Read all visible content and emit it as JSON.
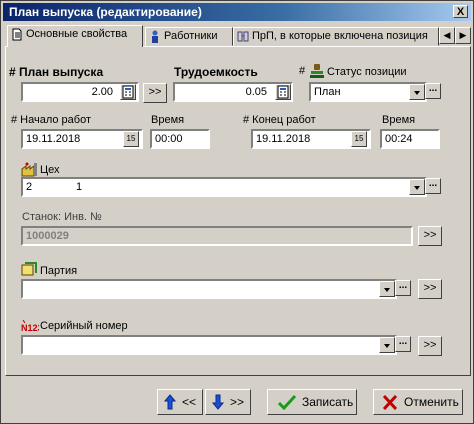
{
  "window": {
    "title": "План выпуска (редактирование)",
    "close_glyph": "X"
  },
  "tabs": [
    {
      "label": "Основные свойства",
      "icon": "document-icon",
      "active": true
    },
    {
      "label": "Работники",
      "icon": "worker-icon",
      "active": false
    },
    {
      "label": "ПрП, в которые включена позиция",
      "icon": "link-icon",
      "active": false
    }
  ],
  "form": {
    "plan_label": "# План выпуска",
    "plan_value": "2.00",
    "labor_label": "Трудоемкость",
    "labor_value": "0.05",
    "status_label": "# Статус позиции",
    "status_value": "План",
    "start_label": "# Начало работ",
    "start_date": "19.11.2018",
    "start_time_label": "Время",
    "start_time": "00:00",
    "end_label": "# Конец работ",
    "end_date": "19.11.2018",
    "end_time_label": "Время",
    "end_time": "00:24",
    "shop_label": "Цех",
    "shop_code": "2",
    "shop_name": "1",
    "machine_label": "Станок: Инв. №",
    "machine_value": "1000029",
    "batch_label": "Партия",
    "batch_value": "",
    "serial_label": "Серийный номер",
    "serial_value": "",
    "goto_glyph": ">>",
    "dots_glyph": "...",
    "cal_day": "15"
  },
  "footer": {
    "prev_label": "<<",
    "next_label": ">>",
    "save_label": "Записать",
    "cancel_label": "Отменить"
  },
  "colors": {
    "titlebar": "#0a246a",
    "arrows": "#1a4fd8",
    "save_check": "#1a9a1a",
    "cancel_x": "#c00000"
  }
}
